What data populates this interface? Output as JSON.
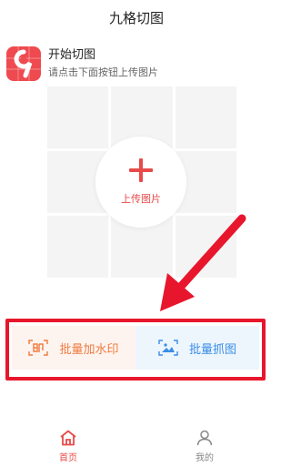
{
  "header": {
    "title": "九格切图"
  },
  "intro": {
    "title": "开始切图",
    "subtitle": "请点击下面按钮上传图片"
  },
  "upload": {
    "label": "上传图片"
  },
  "actions": [
    {
      "label": "批量加水印",
      "icon": "watermark-icon"
    },
    {
      "label": "批量抓图",
      "icon": "image-grab-icon"
    }
  ],
  "tabbar": [
    {
      "label": "首页",
      "icon": "home-icon",
      "active": true
    },
    {
      "label": "我的",
      "icon": "user-icon",
      "active": false
    }
  ],
  "colors": {
    "accent": "#e84a4a",
    "annotation": "#e8162c",
    "blue": "#3a8ee6",
    "orange": "#f07b3f"
  }
}
